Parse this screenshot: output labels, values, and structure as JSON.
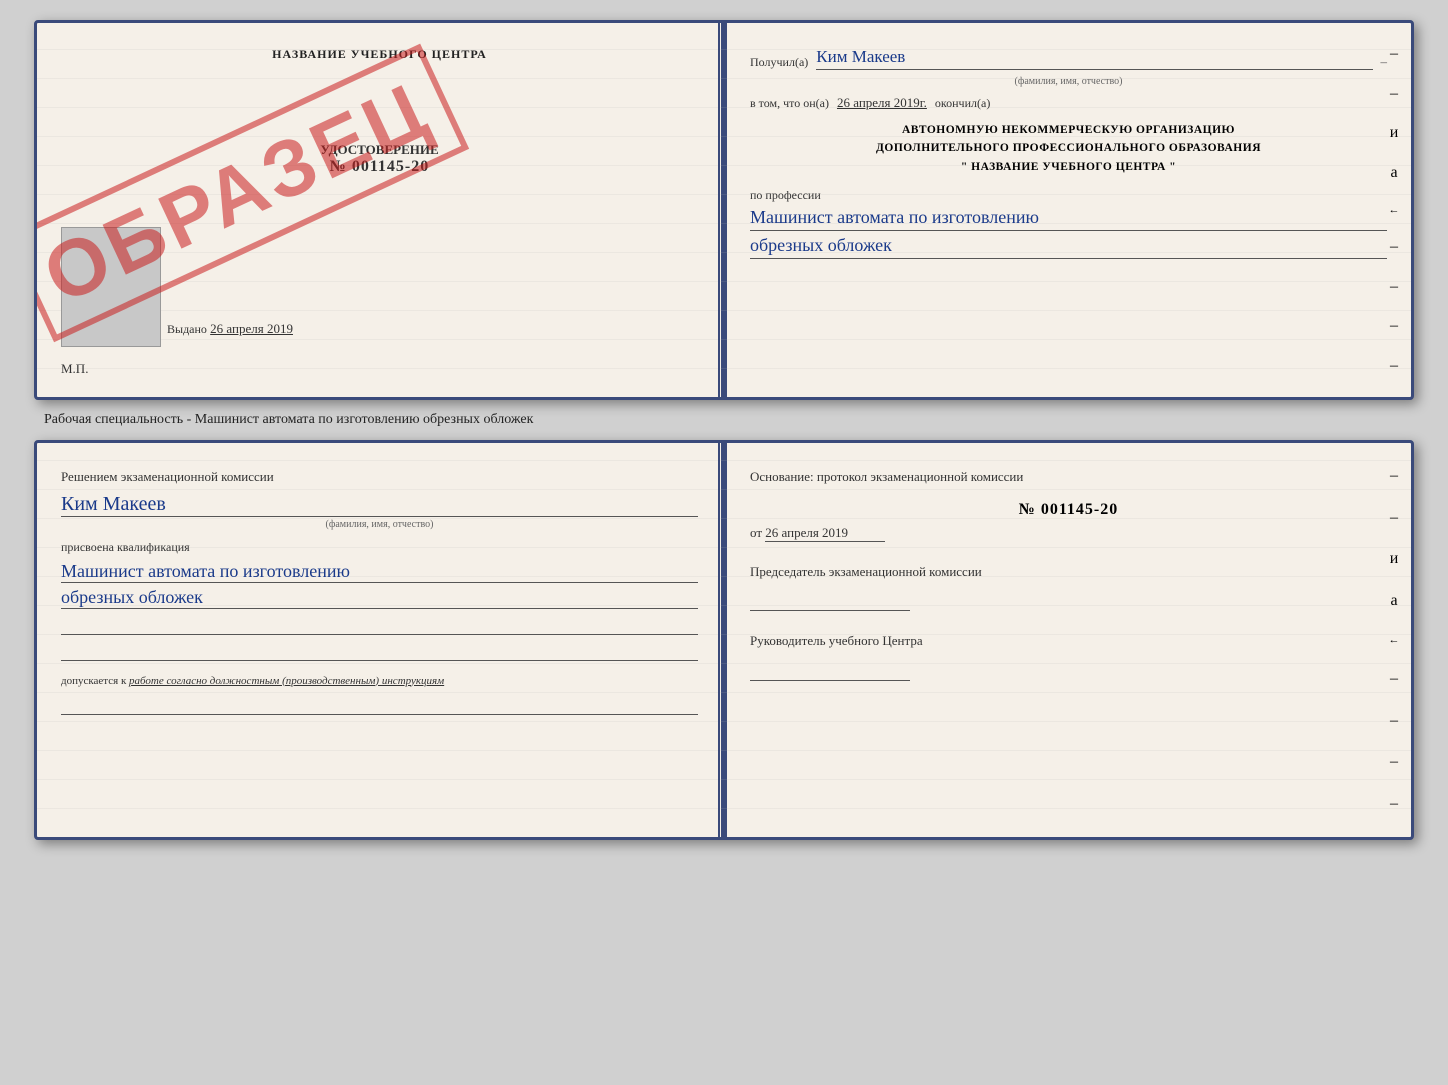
{
  "top_cert": {
    "left": {
      "title": "НАЗВАНИЕ УЧЕБНОГО ЦЕНТРА",
      "udost_label": "УДОСТОВЕРЕНИЕ",
      "number": "№ 001145-20",
      "vidan_label": "Выдано",
      "vidan_date": "26 апреля 2019",
      "mp_label": "М.П.",
      "stamp_text": "ОБРАЗЕЦ"
    },
    "right": {
      "poluchil_label": "Получил(а)",
      "poluchil_name": "Ким Макеев",
      "name_subtext": "(фамилия, имя, отчество)",
      "vtom_label": "в том, что он(а)",
      "vtom_date": "26 апреля 2019г.",
      "okonchil_label": "окончил(а)",
      "org_line1": "АВТОНОМНУЮ НЕКОММЕРЧЕСКУЮ ОРГАНИЗАЦИЮ",
      "org_line2": "ДОПОЛНИТЕЛЬНОГО ПРОФЕССИОНАЛЬНОГО ОБРАЗОВАНИЯ",
      "org_line3": "\"  НАЗВАНИЕ УЧЕБНОГО ЦЕНТРА  \"",
      "po_professii_label": "по профессии",
      "profession_line1": "Машинист автомата по изготовлению",
      "profession_line2": "обрезных обложек"
    }
  },
  "subtitle": "Рабочая специальность - Машинист автомата по изготовлению обрезных обложек",
  "bottom_cert": {
    "left": {
      "heading": "Решением экзаменационной комиссии",
      "name": "Ким Макеев",
      "name_subtext": "(фамилия, имя, отчество)",
      "assigned_label": "присвоена квалификация",
      "profession_line1": "Машинист автомата по изготовлению",
      "profession_line2": "обрезных обложек",
      "dopuskaetsya_label": "допускается к",
      "dopuskaetsya_value": "работе согласно должностным (производственным) инструкциям"
    },
    "right": {
      "osnov_label": "Основание: протокол экзаменационной комиссии",
      "number": "№ 001145-20",
      "ot_label": "от",
      "ot_date": "26 апреля 2019",
      "chairman_label": "Председатель экзаменационной комиссии",
      "head_label": "Руководитель учебного Центра"
    }
  },
  "side_marks": {
    "letters": [
      "и",
      "а",
      "←",
      "–",
      "–",
      "–",
      "–",
      "–"
    ],
    "letters2": [
      "и",
      "а",
      "←",
      "–",
      "–",
      "–",
      "–",
      "–"
    ]
  }
}
